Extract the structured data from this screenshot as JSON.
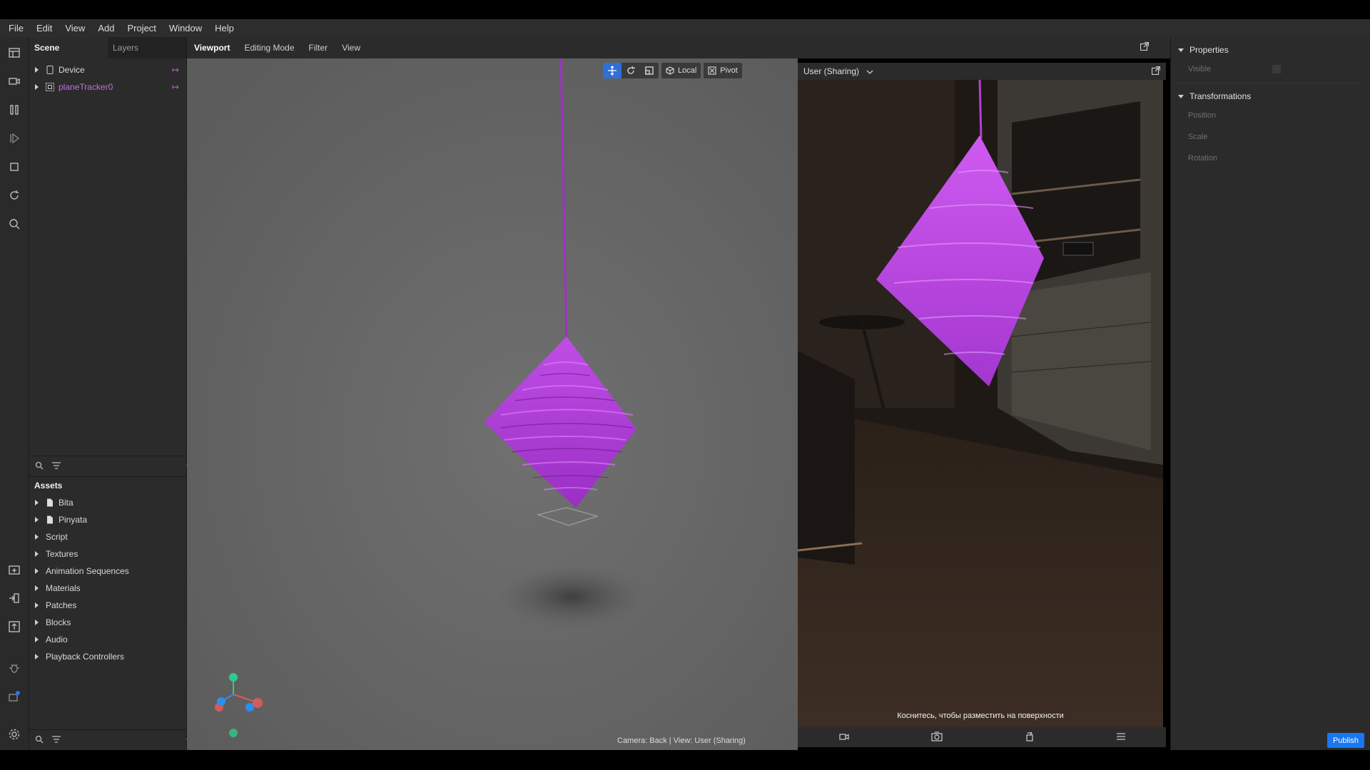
{
  "menu": [
    "File",
    "Edit",
    "View",
    "Add",
    "Project",
    "Window",
    "Help"
  ],
  "scene_panel": {
    "tabs": [
      "Scene",
      "Layers"
    ],
    "items": [
      {
        "label": "Device",
        "icon": "device-icon"
      },
      {
        "label": "planeTracker0",
        "icon": "plane-tracker-icon"
      }
    ]
  },
  "assets_panel": {
    "title": "Assets",
    "items": [
      {
        "label": "Bita",
        "icon": "file-icon"
      },
      {
        "label": "Pinyata",
        "icon": "file-icon"
      },
      {
        "label": "Script"
      },
      {
        "label": "Textures"
      },
      {
        "label": "Animation Sequences"
      },
      {
        "label": "Materials"
      },
      {
        "label": "Patches"
      },
      {
        "label": "Blocks"
      },
      {
        "label": "Audio"
      },
      {
        "label": "Playback Controllers"
      }
    ]
  },
  "viewport": {
    "tabs": [
      "Viewport",
      "Editing Mode",
      "Filter",
      "View"
    ],
    "tools": {
      "local": "Local",
      "pivot": "Pivot"
    },
    "status": "Camera: Back | View: User (Sharing)"
  },
  "simulator": {
    "device": "User (Sharing)",
    "caption": "Коснитесь, чтобы разместить на поверхности"
  },
  "properties": {
    "section1": "Properties",
    "visible_label": "Visible",
    "section2": "Transformations",
    "rows": [
      "Position",
      "Scale",
      "Rotation"
    ]
  },
  "publish_label": "Publish",
  "colors": {
    "accent": "#1877f2",
    "pinata": "#b43cd8",
    "viewport_bg": "#6b6b6b"
  }
}
